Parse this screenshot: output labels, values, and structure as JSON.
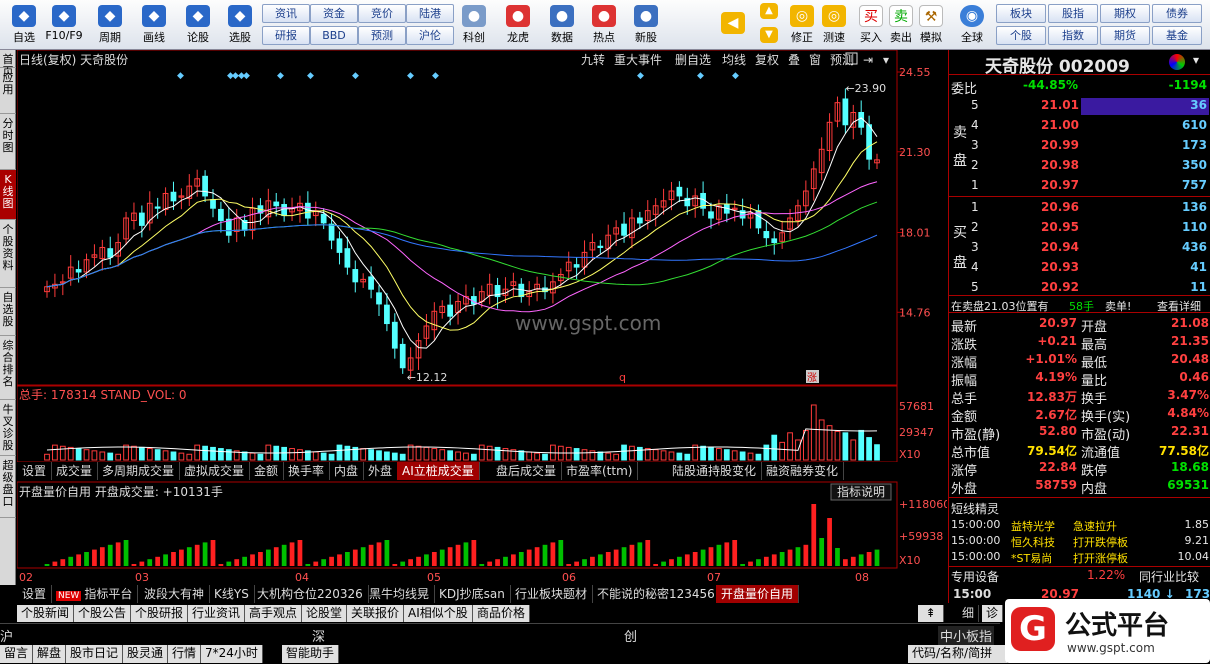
{
  "toolbar": {
    "left": [
      "自选",
      "F10/F9",
      "周期",
      "画线",
      "论股",
      "选股"
    ],
    "left_icons": [
      "star-icon",
      "f10-icon",
      "clock-icon",
      "pencil-icon",
      "lungu-icon",
      "select-icon"
    ],
    "btn_grid": [
      [
        "资讯",
        "资金",
        "竞价",
        "陆港"
      ],
      [
        "研报",
        "BBD",
        "预测",
        "沪伦"
      ]
    ],
    "mid": [
      "科创",
      "龙虎",
      "数据",
      "热点",
      "新股"
    ],
    "mid_icons": [
      "kechuang-icon",
      "dragon-icon",
      "data-icon",
      "hot-icon",
      "newstock-icon"
    ],
    "nav": [
      "修正",
      "测速"
    ],
    "trade": [
      "买入",
      "卖出",
      "模拟"
    ],
    "global": "全球",
    "right_grid": [
      [
        "板块",
        "股指",
        "期权",
        "债券"
      ],
      [
        "个股",
        "指数",
        "期货",
        "基金"
      ]
    ]
  },
  "left_tabs": [
    "首页",
    "应用",
    "分时图",
    "K线图",
    "个股资料",
    "自选股",
    "综合排名",
    "牛叉诊股",
    "超级盘口"
  ],
  "chart": {
    "title": "日线(复权)  天奇股份",
    "buttons": [
      "九转",
      "重大事件",
      "删自选",
      "均线",
      "复权",
      "叠",
      "窗",
      "预测"
    ],
    "y_labels": [
      "24.55",
      "21.30",
      "18.01",
      "14.76"
    ],
    "high_label": "23.90",
    "low_label": "12.12",
    "markers": [
      "q",
      "涨"
    ],
    "watermark": "www.gspt.com",
    "vol_title": "总手: 178314  STAND_VOL: 0",
    "vol_labels": [
      "57681",
      "29347",
      "X10"
    ],
    "ind_title": "开盘量价自用  开盘成交量: +10131手",
    "ind_button": "指标说明",
    "ind_labels": [
      "+118060",
      "+59938",
      "X10"
    ],
    "x_labels": [
      "02",
      "03",
      "04",
      "05",
      "06",
      "07",
      "08"
    ]
  },
  "chart_data": {
    "type": "candlestick",
    "title": "日线(复权)  天奇股份",
    "ylim": [
      12.0,
      24.55
    ],
    "high": 23.9,
    "low": 12.12,
    "x_ticks": [
      "02",
      "03",
      "04",
      "05",
      "06",
      "07",
      "08"
    ],
    "close": [
      15.8,
      15.9,
      16.0,
      16.6,
      16.4,
      16.9,
      17.1,
      17.4,
      17.0,
      17.6,
      18.6,
      18.8,
      18.3,
      19.2,
      19.0,
      19.6,
      19.3,
      19.5,
      19.9,
      20.2,
      19.5,
      19.0,
      18.5,
      17.9,
      18.6,
      18.1,
      19.0,
      18.8,
      19.3,
      19.1,
      18.7,
      19.0,
      19.2,
      18.6,
      18.9,
      18.4,
      17.7,
      17.2,
      16.6,
      16.0,
      16.1,
      15.7,
      15.1,
      14.3,
      13.3,
      12.5,
      12.9,
      13.6,
      14.2,
      14.8,
      15.0,
      14.6,
      15.2,
      15.4,
      15.1,
      15.6,
      15.9,
      15.4,
      15.7,
      16.0,
      15.4,
      15.6,
      15.9,
      15.6,
      16.0,
      16.3,
      16.8,
      16.6,
      17.2,
      17.6,
      17.4,
      17.9,
      18.2,
      17.9,
      18.6,
      18.4,
      18.9,
      19.1,
      19.3,
      19.7,
      19.5,
      19.1,
      19.5,
      19.0,
      18.6,
      19.1,
      18.8,
      19.0,
      18.6,
      18.8,
      18.2,
      17.8,
      17.6,
      18.0,
      18.6,
      19.1,
      19.7,
      20.6,
      21.4,
      22.5,
      23.3,
      22.4,
      22.9,
      22.3,
      21.0,
      20.97
    ],
    "vol_scale": [
      0,
      57681
    ],
    "volume_peak": 57681,
    "indicator": {
      "name": "开盘量价自用",
      "value": "+10131手"
    }
  },
  "quote": {
    "name": "天奇股份",
    "code": "002009",
    "weibi": "委比",
    "weibi_pct": "-44.85%",
    "weibi_val": "-1194",
    "sell_label": [
      "卖",
      "盘"
    ],
    "buy_label": [
      "买",
      "盘"
    ],
    "asks": [
      {
        "lv": "5",
        "p": "21.01",
        "v": "36"
      },
      {
        "lv": "4",
        "p": "21.00",
        "v": "610"
      },
      {
        "lv": "3",
        "p": "20.99",
        "v": "173"
      },
      {
        "lv": "2",
        "p": "20.98",
        "v": "350"
      },
      {
        "lv": "1",
        "p": "20.97",
        "v": "757"
      }
    ],
    "bids": [
      {
        "lv": "1",
        "p": "20.96",
        "v": "136"
      },
      {
        "lv": "2",
        "p": "20.95",
        "v": "110"
      },
      {
        "lv": "3",
        "p": "20.94",
        "v": "436"
      },
      {
        "lv": "4",
        "p": "20.93",
        "v": "41"
      },
      {
        "lv": "5",
        "p": "20.92",
        "v": "11"
      }
    ],
    "notice": "在卖盘21.03位置有",
    "notice_num": "58手",
    "notice_tag": "卖单!",
    "notice_link": "查看详细",
    "stats": [
      [
        "最新",
        "20.97",
        "开盘",
        "21.08"
      ],
      [
        "涨跌",
        "+0.21",
        "最高",
        "21.35"
      ],
      [
        "涨幅",
        "+1.01%",
        "最低",
        "20.48"
      ],
      [
        "振幅",
        "4.19%",
        "量比",
        "0.46"
      ],
      [
        "总手",
        "12.83万",
        "换手",
        "3.47%"
      ],
      [
        "金额",
        "2.67亿",
        "换手(实)",
        "4.84%"
      ],
      [
        "市盈(静)",
        "52.80",
        "市盈(动)",
        "22.31"
      ],
      [
        "总市值",
        "79.54亿",
        "流通值",
        "77.58亿"
      ],
      [
        "涨停",
        "22.84",
        "跌停",
        "18.68"
      ],
      [
        "外盘",
        "58759",
        "内盘",
        "69531"
      ]
    ],
    "short_title": "短线精灵",
    "elves": [
      {
        "t": "15:00:00",
        "n": "益特光学",
        "e": "急速拉升",
        "v": "1.85"
      },
      {
        "t": "15:00:00",
        "n": "恒久科技",
        "e": "打开跌停板",
        "v": "9.21"
      },
      {
        "t": "15:00:00",
        "n": "*ST易尚",
        "e": "打开涨停板",
        "v": "10.04"
      }
    ],
    "special": "专用设备",
    "special_pct": "1.22%",
    "compare": "同行业比较",
    "tick_time": "15:00",
    "tick_price": "20.97",
    "tick_vol": "1140",
    "tick_extra": "173"
  },
  "vol_tabs": [
    "设置",
    "成交量",
    "多周期成交量",
    "虚拟成交量",
    "金额",
    "换手率",
    "内盘",
    "外盘",
    "AI立桩成交量",
    "盘后成交量",
    "市盈率(ttm)",
    "陆股通持股变化",
    "融资融券变化"
  ],
  "ind_tabs": [
    "设置",
    "指标平台",
    "波段大有神",
    "K线YS",
    "大机构仓位220326",
    "黑牛均线晃",
    "KDJ抄底san",
    "行业板块题材",
    "不能说的秘密123456",
    "开盘量价自用"
  ],
  "ind_new_badge": "NEW",
  "news_tabs": [
    "个股新闻",
    "个股公告",
    "个股研报",
    "行业资讯",
    "高手观点",
    "论股堂",
    "关联报价",
    "AI相似个股",
    "商品价格"
  ],
  "index_row": [
    "沪",
    "深",
    "创",
    "中小板指"
  ],
  "status": [
    "留言",
    "解盘",
    "股市日记",
    "股灵通",
    "行情",
    "7*24小时",
    "智能助手"
  ],
  "status_right": "代码/名称/简拼",
  "logo": "公式平台",
  "logo_url": "www.gspt.com",
  "detail_tabs": [
    "细",
    "诊"
  ]
}
